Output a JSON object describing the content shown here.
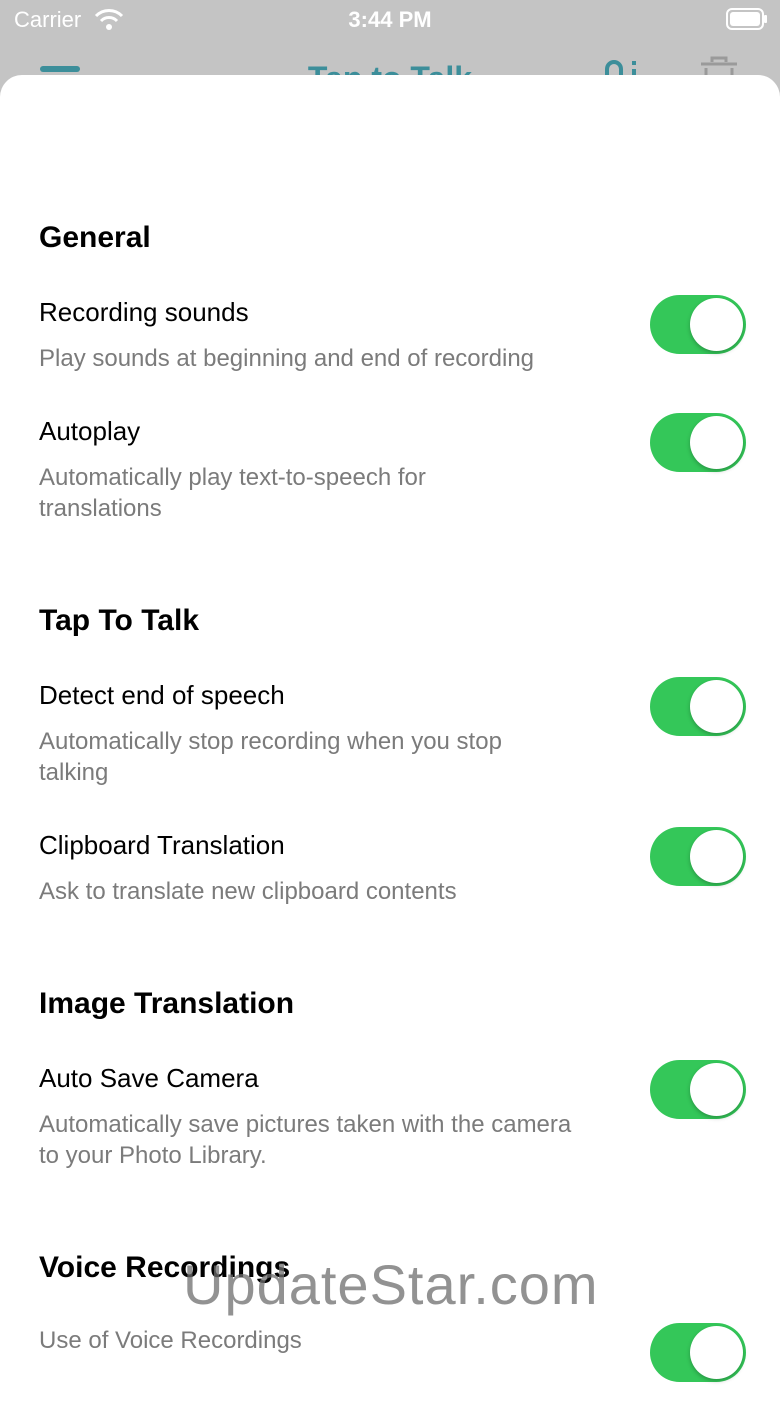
{
  "status_bar": {
    "carrier": "Carrier",
    "time": "3:44 PM"
  },
  "background_nav": {
    "title": "Tap to Talk"
  },
  "sections": {
    "general": {
      "header": "General",
      "recording_sounds": {
        "title": "Recording sounds",
        "desc": "Play sounds at beginning and end of recording",
        "on": true
      },
      "autoplay": {
        "title": "Autoplay",
        "desc": "Automatically play text-to-speech for translations",
        "on": true
      }
    },
    "tap_to_talk": {
      "header": "Tap To Talk",
      "detect_end": {
        "title": "Detect end of speech",
        "desc": "Automatically stop recording when you stop talking",
        "on": true
      },
      "clipboard": {
        "title": "Clipboard Translation",
        "desc": "Ask to translate new clipboard contents",
        "on": true
      }
    },
    "image_translation": {
      "header": "Image Translation",
      "auto_save": {
        "title": "Auto Save Camera",
        "desc": "Automatically save pictures taken with the camera to your Photo Library.",
        "on": true
      }
    },
    "voice_recordings": {
      "header": "Voice Recordings",
      "use_voice": {
        "desc": "Use of Voice Recordings",
        "on": true
      }
    }
  },
  "watermark": "UpdateStar.com",
  "colors": {
    "toggle_on": "#34c759",
    "accent": "#3c8e9a",
    "secondary_text": "#7b7b7b"
  }
}
